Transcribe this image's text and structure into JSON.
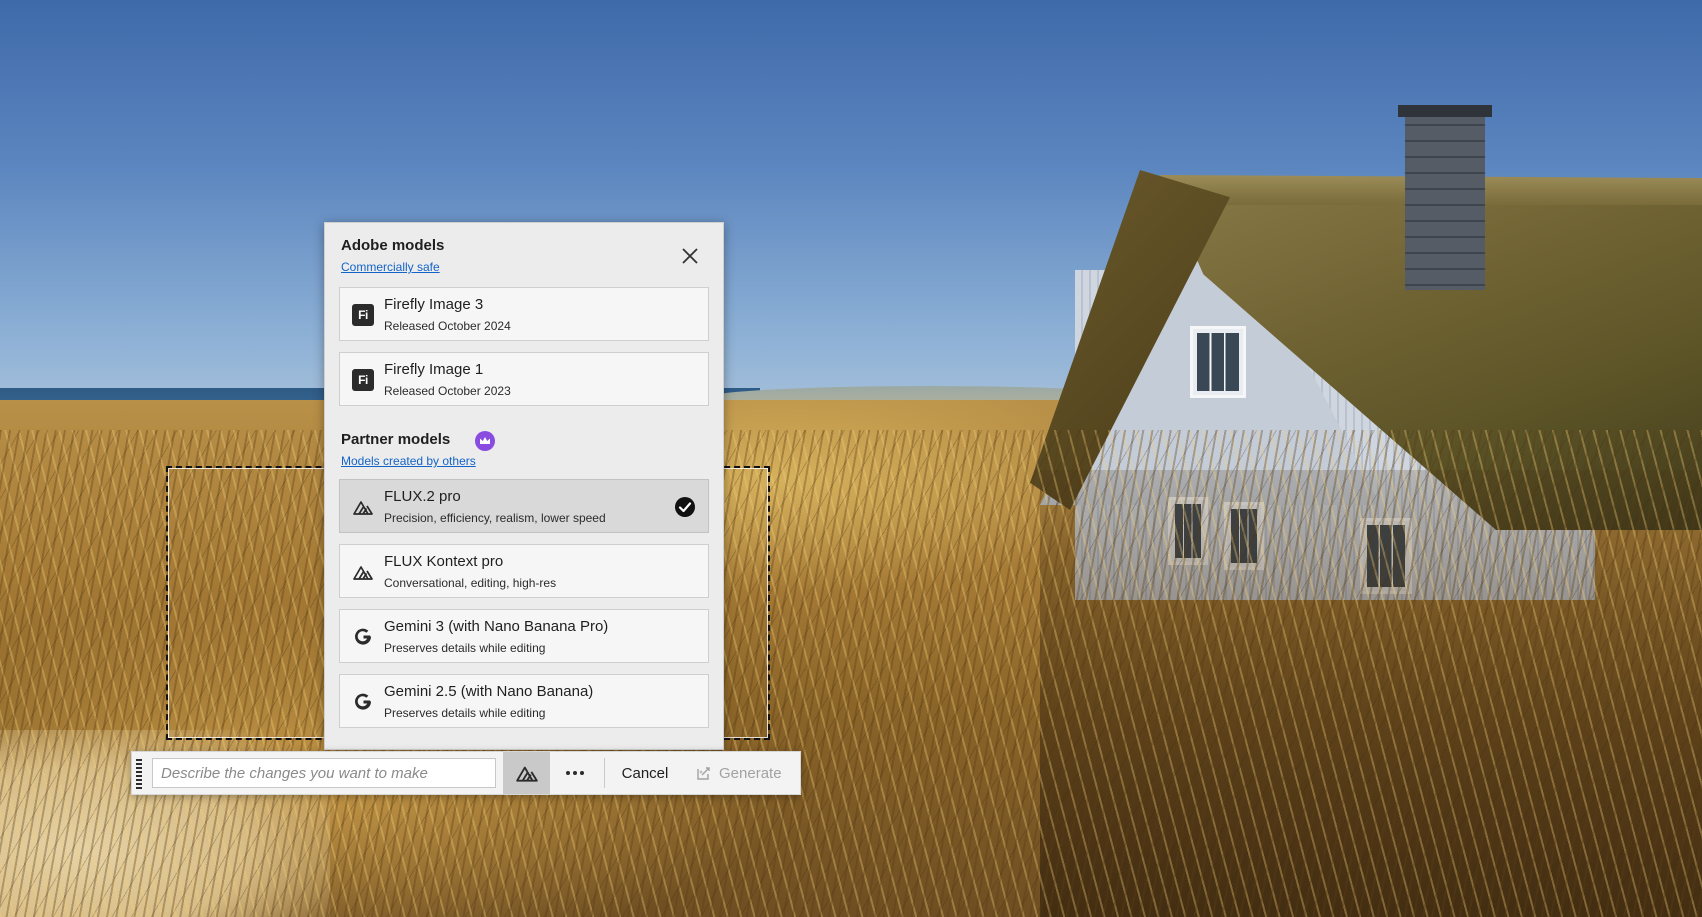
{
  "adobe_section": {
    "title": "Adobe models",
    "link": "Commercially safe"
  },
  "partner_section": {
    "title": "Partner models",
    "link": "Models created by others",
    "badge_icon": "crown-icon",
    "badge_color": "#8a4ce0"
  },
  "adobe_models": [
    {
      "name": "Firefly Image 3",
      "desc": "Released October 2024",
      "icon": "firefly-icon",
      "icon_text": "Fi"
    },
    {
      "name": "Firefly Image 1",
      "desc": "Released October 2023",
      "icon": "firefly-icon",
      "icon_text": "Fi"
    }
  ],
  "partner_models": [
    {
      "name": "FLUX.2 pro",
      "desc": "Precision, efficiency, realism, lower speed",
      "icon": "flux-icon",
      "selected": true
    },
    {
      "name": "FLUX Kontext pro",
      "desc": "Conversational, editing, high-res",
      "icon": "flux-icon",
      "selected": false
    },
    {
      "name": "Gemini 3 (with Nano Banana Pro)",
      "desc": "Preserves details while editing",
      "icon": "google-icon",
      "selected": false
    },
    {
      "name": "Gemini 2.5 (with Nano Banana)",
      "desc": "Preserves details while editing",
      "icon": "google-icon",
      "selected": false
    }
  ],
  "toolbar": {
    "prompt_placeholder": "Describe the changes you want to make",
    "prompt_value": "",
    "model_icon": "flux-icon",
    "more_icon": "more-horizontal-icon",
    "cancel_label": "Cancel",
    "generate_label": "Generate",
    "generate_icon": "generate-icon"
  },
  "colors": {
    "link": "#1464c8",
    "selected_card": "#d9d9d9",
    "disabled_text": "#a2a2a2"
  }
}
